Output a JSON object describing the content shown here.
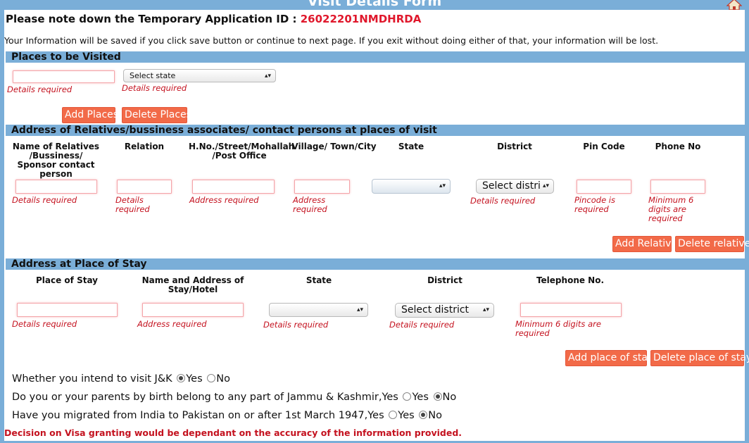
{
  "header": {
    "title": "Visit Details Form",
    "home_icon": "home-icon"
  },
  "app_id": {
    "label": "Please note down the Temporary Application ID : ",
    "value": "26022201NMDHRDA"
  },
  "info_text": "Your Information will be saved if you click save button or continue to next page. If you exit without doing either of that, your information will be lost.",
  "places": {
    "section_title": "Places to be Visited",
    "state_select": "Select state",
    "err_place": "Details required",
    "err_state": "Details required",
    "add_btn": "Add Places",
    "delete_btn": "Delete Places"
  },
  "relatives": {
    "section_title": "Address of Relatives/bussiness associates/ contact persons at places of visit",
    "headers": {
      "name": "Name of Relatives /Bussiness/ Sponsor contact person",
      "relation": "Relation",
      "hno": "H.No./Street/Mohallah /Post Office",
      "village": "Village/ Town/City",
      "state": "State",
      "district": "District",
      "pin": "Pin Code",
      "phone": "Phone No"
    },
    "district_select": "Select distri",
    "errors": {
      "name": "Details required",
      "relation": "Details required",
      "hno": "Address required",
      "village": "Address required",
      "district": "Details required",
      "pin": "Pincode is required",
      "phone": "Minimum 6 digits are required"
    },
    "add_btn": "Add Relative",
    "delete_btn": "Delete relative"
  },
  "stay": {
    "section_title": "Address at Place of Stay",
    "headers": {
      "place": "Place of Stay",
      "name_addr": "Name and Address of Stay/Hotel",
      "state": "State",
      "district": "District",
      "phone": "Telephone No."
    },
    "district_select": "Select district",
    "errors": {
      "place": "Details required",
      "name_addr": "Address required",
      "state": "Details required",
      "district": "Details required",
      "phone": "Minimum 6 digits are required"
    },
    "add_btn": "Add place of stay",
    "delete_btn": "Delete place of stay"
  },
  "questions": {
    "q1": {
      "text": "Whether you intend to visit J&K",
      "yes": "Yes",
      "no": "No",
      "selected": "Yes"
    },
    "q2": {
      "text": "Do you or your parents by birth belong to any part of Jammu & Kashmir,Yes",
      "yes": "Yes",
      "no": "No",
      "selected": "No"
    },
    "q3": {
      "text": "Have you migrated from India to Pakistan on or after 1st March 1947,Yes",
      "yes": "Yes",
      "no": "No",
      "selected": "No"
    }
  },
  "decision_text": "Decision on Visa granting would be dependant on the accuracy of the information provided."
}
